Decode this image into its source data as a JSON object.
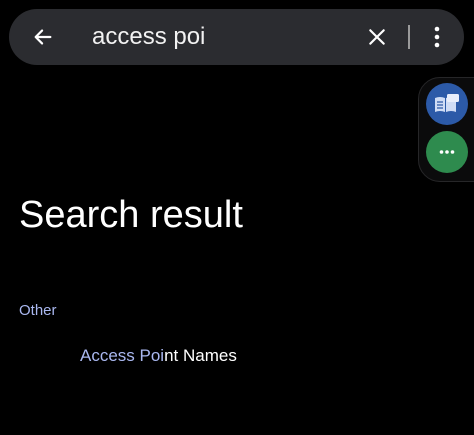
{
  "search": {
    "query": "access poi",
    "back_icon": "arrow-left-icon",
    "clear_icon": "close-icon",
    "menu_icon": "more-vertical-icon"
  },
  "side_panel": {
    "items": [
      {
        "icon": "reading-mode-icon",
        "color": "#2c5aa8"
      },
      {
        "icon": "more-horizontal-icon",
        "color": "#2e8b4e"
      }
    ]
  },
  "main": {
    "heading": "Search result",
    "section_label": "Other",
    "results": [
      {
        "match": "Access Poi",
        "rest": "nt Names"
      }
    ]
  },
  "colors": {
    "background": "#000000",
    "search_bar": "#2b2c30",
    "accent": "#aab8f0",
    "text": "#ffffff"
  }
}
